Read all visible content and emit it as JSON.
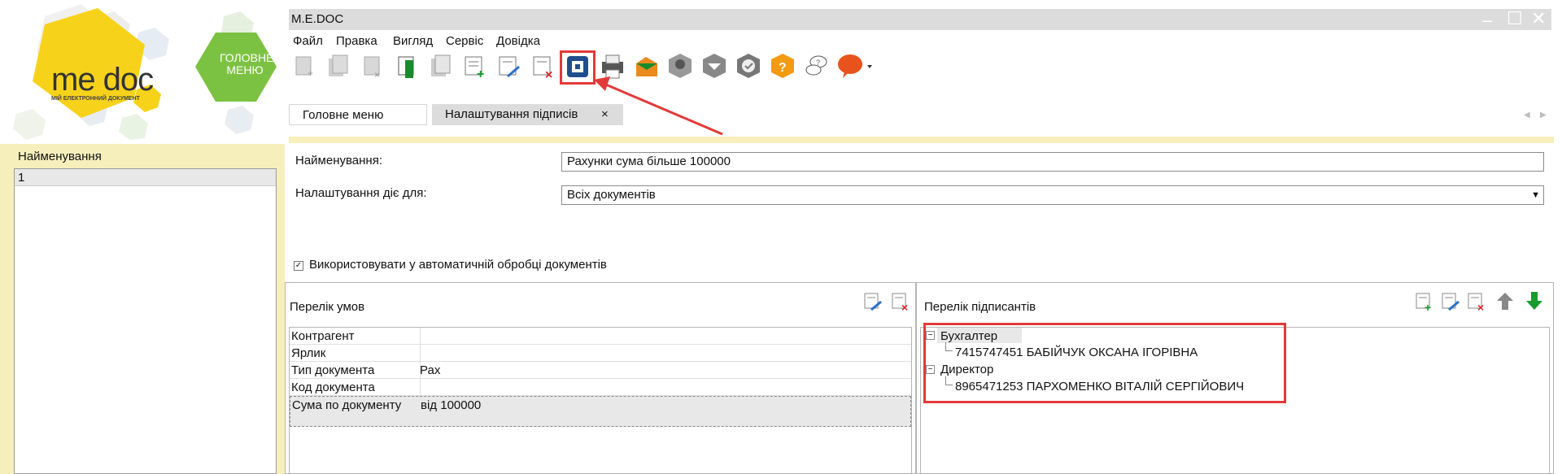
{
  "app": {
    "title": "M.E.DOC",
    "logo_text": "me doc",
    "logo_subtitle": "МІЙ ЕЛЕКТРОННИЙ ДОКУМЕНТ",
    "main_menu_tile": "ГОЛОВНЕ МЕНЮ"
  },
  "menu": [
    "Файл",
    "Правка",
    "Вигляд",
    "Сервіс",
    "Довідка"
  ],
  "toolbar_icons": [
    "new-doc-icon",
    "copy-doc-icon",
    "delete-doc-icon",
    "export-icon",
    "duplicate-icon",
    "add-row-icon",
    "edit-row-icon",
    "delete-row-icon",
    "signature-settings-icon",
    "print-icon",
    "send-icon",
    "search-icon",
    "inbox-icon",
    "approve-icon",
    "help-icon",
    "chat-icon",
    "feedback-icon"
  ],
  "tabs": [
    {
      "label": "Головне меню"
    },
    {
      "label": "Налаштування підписів",
      "close": "×"
    }
  ],
  "left_panel": {
    "header": "Найменування",
    "items": [
      "1"
    ]
  },
  "form": {
    "name_label": "Найменування:",
    "name_value": "Рахунки сума більше 100000",
    "applies_label": "Налаштування діє для:",
    "applies_value": "Всіх документів",
    "auto_check_label": "Використовувати у автоматичній обробці документів",
    "auto_check_checked": true
  },
  "conditions": {
    "title": "Перелік умов",
    "rows": [
      {
        "name": "Контрагент",
        "value": ""
      },
      {
        "name": "Ярлик",
        "value": ""
      },
      {
        "name": "Тип документа",
        "value": "Рах"
      },
      {
        "name": "Код документа",
        "value": ""
      },
      {
        "name": "Сума по документу",
        "value": "від 100000"
      }
    ]
  },
  "signers": {
    "title": "Перелік підписантів",
    "groups": [
      {
        "role": "Бухгалтер",
        "person": "7415747451  БАБІЙЧУК ОКСАНА ІГОРІВНА"
      },
      {
        "role": "Директор",
        "person": "8965471253  ПАРХОМЕНКО ВІТАЛІЙ СЕРГІЙОВИЧ"
      }
    ]
  },
  "colors": {
    "highlight": "#e23a3a",
    "panel_bg": "#f6efbc",
    "logo_yellow": "#f7d21a",
    "tile_green": "#7cc242"
  }
}
